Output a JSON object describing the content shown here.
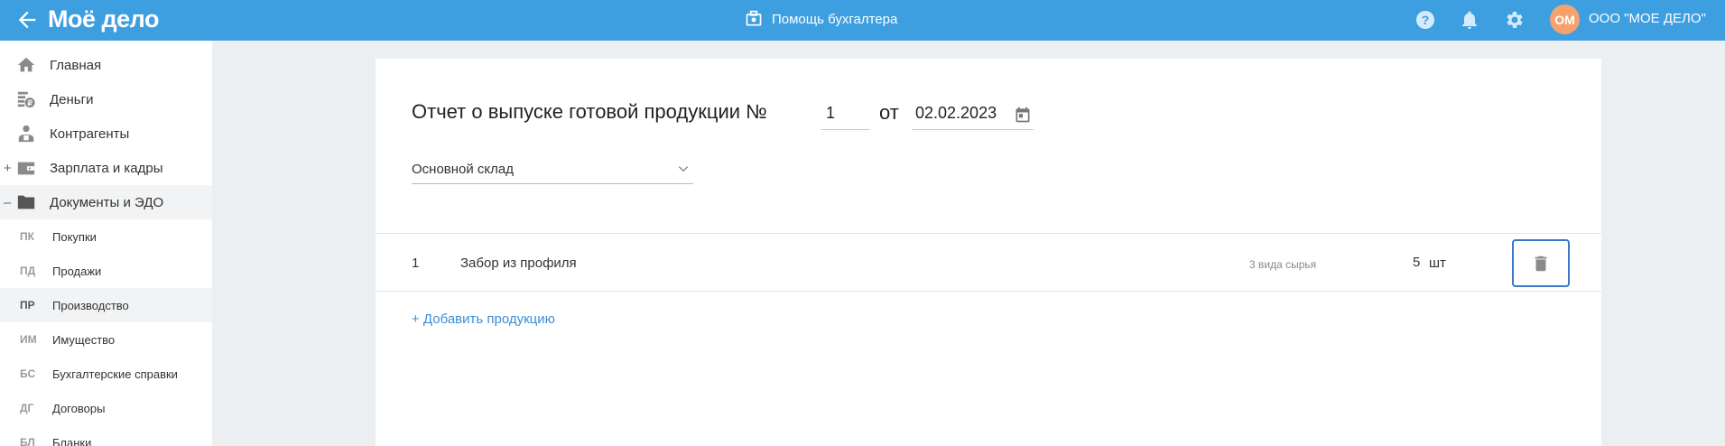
{
  "header": {
    "logo": "Моё дело",
    "helper_label": "Помощь бухгалтера",
    "avatar_initials": "ОМ",
    "company_name": "ООО \"МОЕ ДЕЛО\""
  },
  "sidebar": {
    "items": [
      {
        "label": "Главная",
        "prefix": ""
      },
      {
        "label": "Деньги",
        "prefix": ""
      },
      {
        "label": "Контрагенты",
        "prefix": ""
      },
      {
        "label": "Зарплата и кадры",
        "prefix": "+"
      },
      {
        "label": "Документы и ЭДО",
        "prefix": "–"
      }
    ],
    "sub_items": [
      {
        "abbr": "ПК",
        "label": "Покупки"
      },
      {
        "abbr": "ПД",
        "label": "Продажи"
      },
      {
        "abbr": "ПР",
        "label": "Производство"
      },
      {
        "abbr": "ИМ",
        "label": "Имущество"
      },
      {
        "abbr": "БС",
        "label": "Бухгалтерские справки"
      },
      {
        "abbr": "ДГ",
        "label": "Договоры"
      },
      {
        "abbr": "БЛ",
        "label": "Бланки"
      }
    ]
  },
  "document": {
    "title": "Отчет о выпуске готовой продукции №",
    "number": "1",
    "from_label": "от",
    "date": "02.02.2023",
    "warehouse": "Основной склад",
    "rows": [
      {
        "num": "1",
        "name": "Забор из профиля",
        "raw": "3 вида сырья",
        "qty": "5",
        "unit": "шт"
      }
    ],
    "add_label": "+ Добавить продукцию"
  },
  "colors": {
    "header_bg": "#3d9fe0",
    "link": "#3d8fd6",
    "avatar": "#f5a26e",
    "delete_border": "#3a78c8"
  }
}
